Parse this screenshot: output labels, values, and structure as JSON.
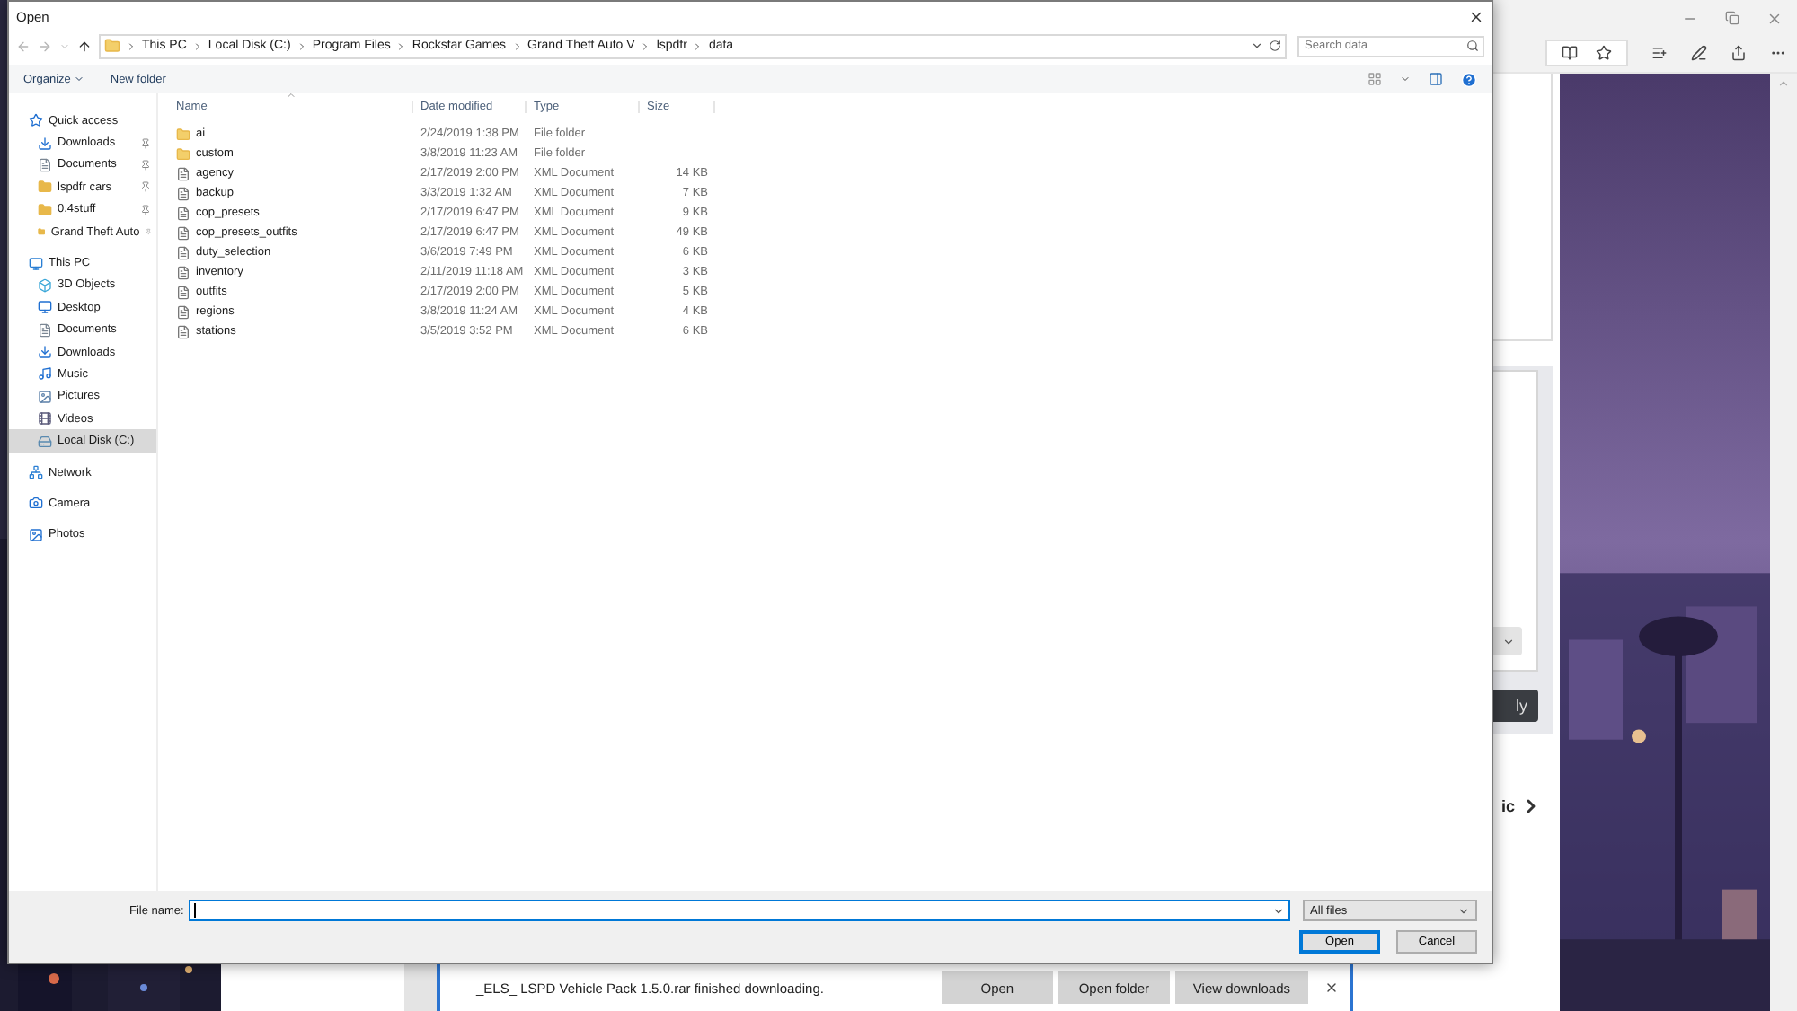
{
  "window": {
    "title": "Open"
  },
  "breadcrumb": [
    "This PC",
    "Local Disk (C:)",
    "Program Files",
    "Rockstar Games",
    "Grand Theft Auto V",
    "lspdfr",
    "data"
  ],
  "search": {
    "placeholder": "Search data"
  },
  "toolbar": [
    {
      "label": "Organize",
      "kind": "menu"
    },
    {
      "label": "New folder",
      "kind": "plain"
    }
  ],
  "nav": [
    {
      "label": "Quick access",
      "kind": "star",
      "selected": false,
      "children": [
        {
          "label": "Downloads",
          "kind": "download",
          "pinned": true,
          "selected": false
        },
        {
          "label": "Documents",
          "kind": "document",
          "pinned": true,
          "selected": false
        },
        {
          "label": "lspdfr cars",
          "kind": "folder",
          "pinned": true,
          "selected": false
        },
        {
          "label": "0.4stuff",
          "kind": "folder",
          "pinned": true,
          "selected": false
        },
        {
          "label": "Grand Theft Auto",
          "kind": "folder",
          "pinned": true,
          "selected": false
        }
      ]
    },
    {
      "label": "This PC",
      "kind": "pc",
      "selected": false,
      "children": [
        {
          "label": "3D Objects",
          "kind": "cube",
          "pinned": false,
          "selected": false
        },
        {
          "label": "Desktop",
          "kind": "desktop",
          "pinned": false,
          "selected": false
        },
        {
          "label": "Documents",
          "kind": "document",
          "pinned": false,
          "selected": false
        },
        {
          "label": "Downloads",
          "kind": "download",
          "pinned": false,
          "selected": false
        },
        {
          "label": "Music",
          "kind": "music",
          "pinned": false,
          "selected": false
        },
        {
          "label": "Pictures",
          "kind": "pictures",
          "pinned": false,
          "selected": false
        },
        {
          "label": "Videos",
          "kind": "videos",
          "pinned": false,
          "selected": false
        },
        {
          "label": "Local Disk (C:)",
          "kind": "disk",
          "pinned": false,
          "selected": true
        }
      ]
    },
    {
      "label": "Network",
      "kind": "network",
      "selected": false
    },
    {
      "label": "Camera",
      "kind": "camera",
      "selected": false
    },
    {
      "label": "Photos",
      "kind": "photos",
      "selected": false
    }
  ],
  "columns": [
    "Name",
    "Date modified",
    "Type",
    "Size"
  ],
  "files": [
    {
      "kind": "folder",
      "name": "ai",
      "date": "2/24/2019 1:38 PM",
      "type": "File folder"
    },
    {
      "kind": "folder",
      "name": "custom",
      "date": "3/8/2019 11:23 AM",
      "type": "File folder"
    },
    {
      "kind": "file",
      "name": "agency",
      "date": "2/17/2019 2:00 PM",
      "type": "XML Document",
      "size": "14 KB"
    },
    {
      "kind": "file",
      "name": "backup",
      "date": "3/3/2019 1:32 AM",
      "type": "XML Document",
      "size": "7 KB"
    },
    {
      "kind": "file",
      "name": "cop_presets",
      "date": "2/17/2019 6:47 PM",
      "type": "XML Document",
      "size": "9 KB"
    },
    {
      "kind": "file",
      "name": "cop_presets_outfits",
      "date": "2/17/2019 6:47 PM",
      "type": "XML Document",
      "size": "49 KB"
    },
    {
      "kind": "file",
      "name": "duty_selection",
      "date": "3/6/2019 7:49 PM",
      "type": "XML Document",
      "size": "6 KB"
    },
    {
      "kind": "file",
      "name": "inventory",
      "date": "2/11/2019 11:18 AM",
      "type": "XML Document",
      "size": "3 KB"
    },
    {
      "kind": "file",
      "name": "outfits",
      "date": "2/17/2019 2:00 PM",
      "type": "XML Document",
      "size": "5 KB"
    },
    {
      "kind": "file",
      "name": "regions",
      "date": "3/8/2019 11:24 AM",
      "type": "XML Document",
      "size": "4 KB"
    },
    {
      "kind": "file",
      "name": "stations",
      "date": "3/5/2019 3:52 PM",
      "type": "XML Document",
      "size": "6 KB"
    }
  ],
  "file_name": {
    "label": "File name:",
    "focused": true
  },
  "filter": {
    "value": "All files"
  },
  "buttons": [
    {
      "label": "Open",
      "default": true
    },
    {
      "label": "Cancel",
      "default": false
    }
  ],
  "browser": {
    "partial_button": "ly",
    "partial_text": "ic"
  },
  "download": {
    "message": "_ELS_ LSPD Vehicle Pack 1.5.0.rar finished downloading.",
    "buttons": [
      "Open",
      "Open folder",
      "View downloads"
    ]
  }
}
